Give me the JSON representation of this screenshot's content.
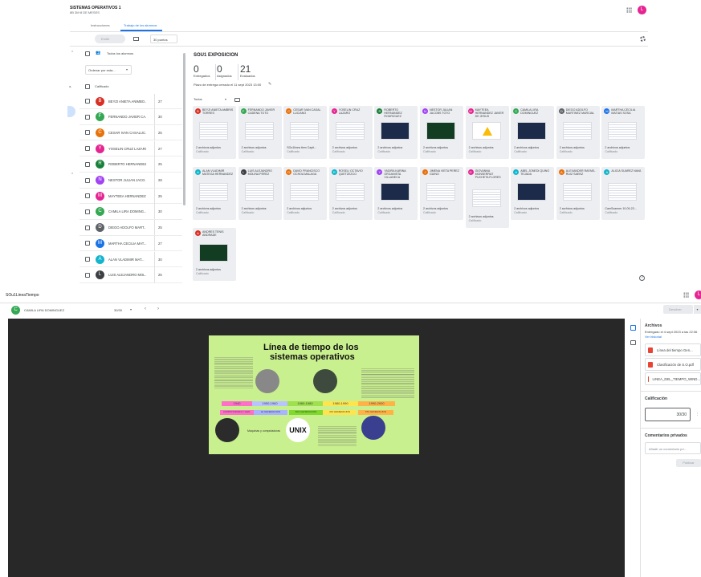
{
  "top": {
    "class_title": "SISTEMAS OPERATIVOS 1",
    "class_subtitle": "8B 3M·8 DE MESES",
    "tabs": [
      "Instrucciones",
      "Trabajo de los alumnos"
    ],
    "return_label": "Emitir",
    "points": "30 puntos",
    "all_students": "Todos los alumnos",
    "sort_label": "Ordenar por esta...",
    "graded_label": "Calificado",
    "avatar_letter": "L"
  },
  "students": [
    {
      "name": "BEYZI ANIETA ANIMBO...",
      "score": "27",
      "color": "#d93025",
      "letter": "B"
    },
    {
      "name": "FERNANDO JAVIER CA...",
      "score": "30",
      "color": "#34a853",
      "letter": "F"
    },
    {
      "name": "CESAR IVAN CASALUC...",
      "score": "25",
      "color": "#e8710a",
      "letter": "C"
    },
    {
      "name": "YOSELIN CRUZ LAZARO",
      "score": "27",
      "color": "#e52592",
      "letter": "Y"
    },
    {
      "name": "ROBERTO HERNANDEZ...",
      "score": "25",
      "color": "#188038",
      "letter": "R"
    },
    {
      "name": "NESTOR JULIAN JACO...",
      "sub": "YOLA PRIOR MUNOZ...",
      "score": "28",
      "color": "#a142f4",
      "letter": "N"
    },
    {
      "name": "MAYTEEA HERNANDEZ...",
      "score": "25",
      "color": "#e52592",
      "letter": "M"
    },
    {
      "name": "CAMILA LIRA DOMING...",
      "score": "30",
      "color": "#34a853",
      "letter": "C"
    },
    {
      "name": "DIEGO ADOLFO MART...",
      "score": "25",
      "color": "#5f6368",
      "letter": "D"
    },
    {
      "name": "MARTHA CECILIA MAT...",
      "score": "27",
      "color": "#1a73e8",
      "letter": "M"
    },
    {
      "name": "ALAN VLADIMIR MAT...",
      "score": "30",
      "color": "#12b5cb",
      "letter": "A"
    },
    {
      "name": "LUIS ALEJANDRO MOL...",
      "score": "25",
      "color": "#3c4043",
      "letter": "L"
    }
  ],
  "assignment": {
    "title": "SOU1 EXPOSICION",
    "stats": [
      {
        "value": "0",
        "label": "Entregados"
      },
      {
        "value": "0",
        "label": "Asignados"
      },
      {
        "value": "21",
        "label": "Evaluados"
      }
    ],
    "deadline": "Plazo de entrega cerrado el 11 sept 2023 13:00",
    "filter": "Todos"
  },
  "cards": [
    {
      "name": "BEYZI ANIETA AMBRIS TORRES",
      "color": "#d93025",
      "letter": "B",
      "att": "2 archivos adjuntos",
      "status": "Calificado",
      "thumb": "doc"
    },
    {
      "name": "FERNANDO JAVIER CADENA TOTO",
      "color": "#34a853",
      "letter": "F",
      "att": "2 archivos adjuntos",
      "status": "Calificado",
      "thumb": "doc"
    },
    {
      "name": "CESAR IVAN CASAL LUCIANO",
      "color": "#e8710a",
      "letter": "C",
      "att": "SOu1linea tiem Capit...",
      "status": "Calificado",
      "thumb": "doc"
    },
    {
      "name": "YOSELIN CRUZ LAZARO",
      "color": "#e52592",
      "letter": "Y",
      "att": "2 archivos adjuntos",
      "status": "Calificado",
      "thumb": "doc"
    },
    {
      "name": "ROBERTO HERNANDEZ RODRIGUEZ",
      "color": "#188038",
      "letter": "R",
      "att": "2 archivos adjuntos",
      "status": "Calificado",
      "thumb": "dark"
    },
    {
      "name": "NESTOR JULIAN JACOBS TOTO",
      "color": "#a142f4",
      "letter": "N",
      "att": "2 archivos adjuntos",
      "status": "Calificado",
      "thumb": "green"
    },
    {
      "name": "MAYTEEA HERNANDEZ JAVIER DE JESUS",
      "color": "#e52592",
      "letter": "M",
      "att": "2 archivos adjuntos",
      "status": "Calificado",
      "thumb": "drive"
    },
    {
      "name": "CAMILA LIRA DOMINGUEZ",
      "color": "#34a853",
      "letter": "C",
      "att": "2 archivos adjuntos",
      "status": "Calificado",
      "thumb": "dark"
    },
    {
      "name": "DIEGO ADOLFO MARTINEZ MARCIAL",
      "color": "#5f6368",
      "letter": "D",
      "att": "2 archivos adjuntos",
      "status": "Calificado",
      "thumb": "purple"
    },
    {
      "name": "MARTHA CECILIA MATIAS SOSA",
      "color": "#1a73e8",
      "letter": "M",
      "att": "2 archivos adjuntos",
      "status": "Calificado",
      "thumb": "doc"
    },
    {
      "name": "ALAN VLADIMIR MATEGA HERNANDEZ",
      "color": "#12b5cb",
      "letter": "A",
      "att": "2 archivos adjuntos",
      "status": "Calificado",
      "thumb": "doc"
    },
    {
      "name": "LUIS ALEJANDRO MOLINA PEREZ",
      "color": "#3c4043",
      "letter": "L",
      "att": "2 archivos adjuntos",
      "status": "Calificado",
      "thumb": "doc"
    },
    {
      "name": "David Francisco Ochoa Malaga",
      "color": "#e8710a",
      "letter": "D",
      "att": "2 archivos adjuntos",
      "status": "Calificado",
      "thumb": "doc"
    },
    {
      "name": "ROSELI OCTAVIO QUETZEZCO",
      "color": "#12b5cb",
      "letter": "R",
      "att": "2 archivos adjuntos",
      "status": "Calificado",
      "thumb": "doc"
    },
    {
      "name": "YADIRA KARINA ORGANISTA VILLANECA",
      "color": "#a142f4",
      "letter": "Y",
      "att": "2 archivos adjuntos",
      "status": "Calificado",
      "thumb": "dark"
    },
    {
      "name": "JIMENA VIETA PEREZ GUINO",
      "color": "#e8710a",
      "letter": "J",
      "att": "2 archivos adjuntos",
      "status": "Calificado",
      "thumb": "doc"
    },
    {
      "name": "GIOVANNA MONSERRAT PUCHETA FLORES",
      "color": "#e52592",
      "letter": "G",
      "att": "2 archivos adjuntos",
      "status": "Calificado",
      "thumb": "doc"
    },
    {
      "name": "ABEL JONEDI QUINO TEJADA",
      "color": "#12b5cb",
      "letter": "A",
      "att": "2 archivos adjuntos",
      "status": "Calificado",
      "thumb": "dark"
    },
    {
      "name": "ALEXANDER RAFAEL RUIZ SAENZ",
      "color": "#e8710a",
      "letter": "A",
      "att": "2 archivos adjuntos",
      "status": "Calificado",
      "thumb": "purple"
    },
    {
      "name": "ALICIA SUAREZ NAVA",
      "color": "#12b5cb",
      "letter": "A",
      "att": "CamScanner 10-09-23...",
      "status": "Calificado",
      "thumb": "doc"
    },
    {
      "name": "ANDRES TENIS ANDRADE",
      "color": "#d93025",
      "letter": "A",
      "att": "2 archivos adjuntos",
      "status": "Calificado",
      "thumb": "green"
    }
  ],
  "viewer": {
    "doc_title": "SOu1LineaTiempo",
    "student": "CAMILA LIRA DOMINGUEZ",
    "score": "30/30",
    "return_button": "Devolver",
    "slide_title_1": "Línea de tiempo de los",
    "slide_title_2": "sistemas operativos",
    "unix_logo_text": "UNIX",
    "slide_years": [
      "1940",
      "1950-1960",
      "1960-1980",
      "1980-1990",
      "1990-2000"
    ],
    "slide_gens": [
      "COMPUTADORA 1 GEN.",
      "2a GENERACION",
      "3RA GENERACION",
      "4TA GENERACION",
      "5TA GENERACION"
    ],
    "slide_caption": "Maquinas y computadoras",
    "files_header": "Archivos",
    "delivered": "Entregado el 4 sept 2023 a las 22:36",
    "history": "Ver historial",
    "files": [
      "Línea del tiempo Gen...",
      "Clasificación de S.O.pdf",
      "LINEA_DEL_TIEMPO_WIND..."
    ],
    "grade_header": "Calificación",
    "grade_value": "30/30",
    "comments_header": "Comentarios privados",
    "comment_placeholder": "Añadir un comentario pri...",
    "publish": "Publicar",
    "avatar_letter": "L"
  }
}
